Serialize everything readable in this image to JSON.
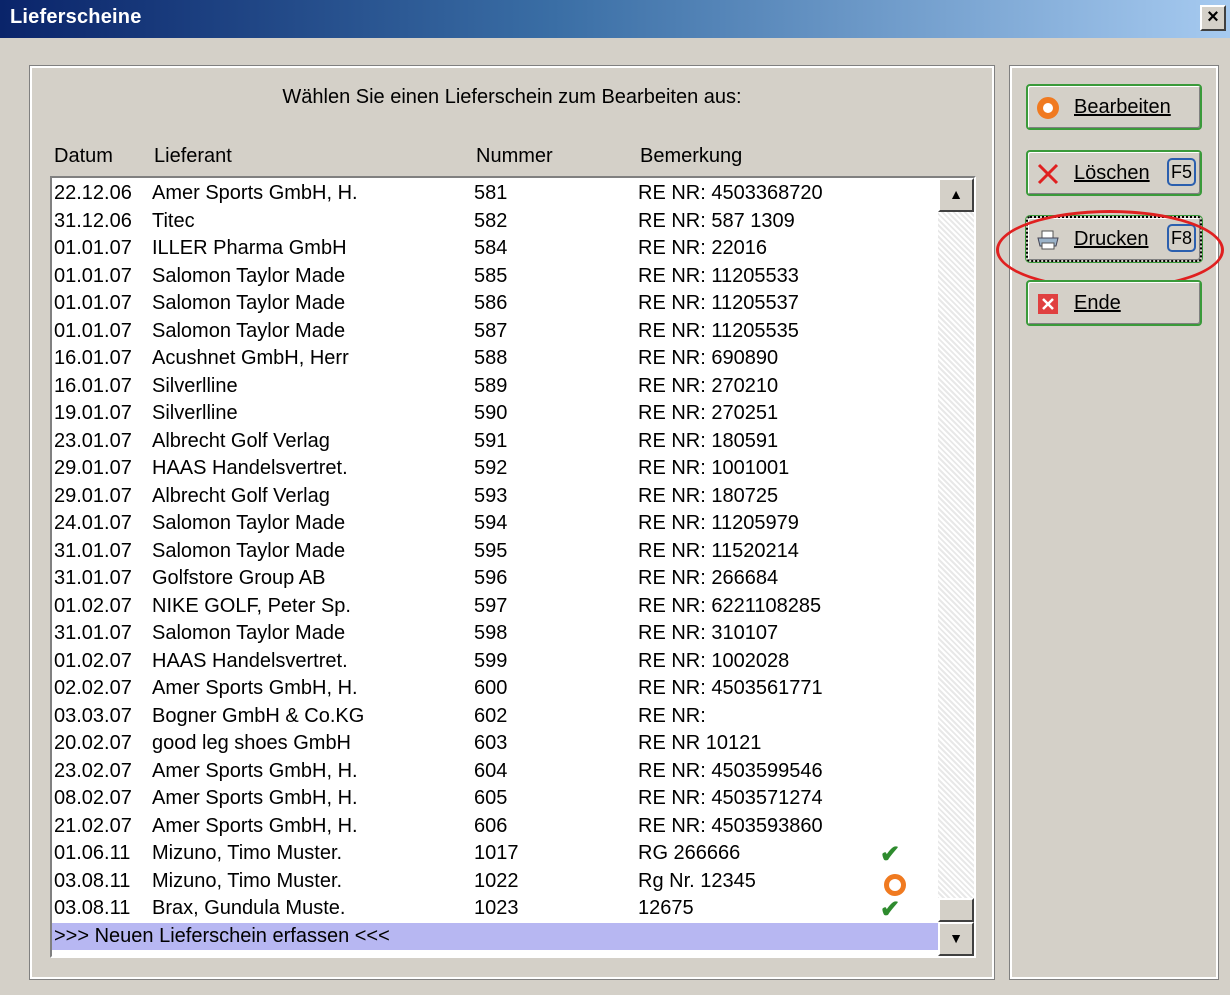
{
  "window": {
    "title": "Lieferscheine",
    "close_label": "×"
  },
  "instruction": "Wählen Sie einen Lieferschein zum Bearbeiten aus:",
  "columns": [
    "Datum",
    "Lieferant",
    "Nummer",
    "Bemerkung"
  ],
  "rows": [
    [
      "22.12.06",
      "Amer Sports GmbH, H.",
      "581",
      "RE NR: 4503368720",
      ""
    ],
    [
      "31.12.06",
      "Titec",
      "582",
      "RE NR: 587 1309",
      ""
    ],
    [
      "01.01.07",
      "ILLER Pharma GmbH",
      "584",
      "RE NR: 22016",
      ""
    ],
    [
      "01.01.07",
      "Salomon Taylor Made",
      "585",
      "RE NR: 11205533",
      ""
    ],
    [
      "01.01.07",
      "Salomon Taylor Made",
      "586",
      "RE NR: 11205537",
      ""
    ],
    [
      "01.01.07",
      "Salomon Taylor Made",
      "587",
      "RE NR: 11205535",
      ""
    ],
    [
      "16.01.07",
      "Acushnet GmbH, Herr",
      "588",
      "RE NR: 690890",
      ""
    ],
    [
      "16.01.07",
      "Silverlline",
      "589",
      "RE NR: 270210",
      ""
    ],
    [
      "19.01.07",
      "Silverlline",
      "590",
      "RE NR: 270251",
      ""
    ],
    [
      "23.01.07",
      "Albrecht Golf Verlag",
      "591",
      "RE NR: 180591",
      ""
    ],
    [
      "29.01.07",
      "HAAS Handelsvertret.",
      "592",
      "RE NR: 1001001",
      ""
    ],
    [
      "29.01.07",
      "Albrecht Golf Verlag",
      "593",
      "RE NR: 180725",
      ""
    ],
    [
      "24.01.07",
      "Salomon Taylor Made",
      "594",
      "RE NR: 11205979",
      ""
    ],
    [
      "31.01.07",
      "Salomon Taylor Made",
      "595",
      "RE NR: 11520214",
      ""
    ],
    [
      "31.01.07",
      "Golfstore Group AB",
      "596",
      "RE NR: 266684",
      ""
    ],
    [
      "01.02.07",
      "NIKE GOLF, Peter Sp.",
      "597",
      "RE NR: 6221108285",
      ""
    ],
    [
      "31.01.07",
      "Salomon Taylor Made",
      "598",
      "RE NR: 310107",
      ""
    ],
    [
      "01.02.07",
      "HAAS Handelsvertret.",
      "599",
      "RE NR: 1002028",
      ""
    ],
    [
      "02.02.07",
      "Amer Sports GmbH, H.",
      "600",
      "RE NR: 4503561771",
      ""
    ],
    [
      "03.03.07",
      "Bogner GmbH & Co.KG",
      "602",
      "RE NR:",
      ""
    ],
    [
      "20.02.07",
      "good leg shoes GmbH",
      "603",
      "RE NR 10121",
      ""
    ],
    [
      "23.02.07",
      "Amer Sports GmbH, H.",
      "604",
      "RE NR: 4503599546",
      ""
    ],
    [
      "08.02.07",
      "Amer Sports GmbH, H.",
      "605",
      "RE NR: 4503571274",
      ""
    ],
    [
      "21.02.07",
      "Amer Sports GmbH, H.",
      "606",
      "RE NR: 4503593860",
      ""
    ],
    [
      "01.06.11",
      "Mizuno, Timo Muster.",
      "1017",
      "RG 266666",
      "check-icon"
    ],
    [
      "03.08.11",
      "Mizuno, Timo Muster.",
      "1022",
      "Rg Nr. 12345",
      "ring-icon"
    ],
    [
      "03.08.11",
      "Brax, Gundula Muste.",
      "1023",
      "12675",
      "check-icon"
    ]
  ],
  "new_entry_label": ">>> Neuen Lieferschein erfassen <<<",
  "scrollbar": {
    "up_label": "▲",
    "down_label": "▼"
  },
  "buttons": {
    "edit": {
      "label": "Bearbeiten",
      "key": ""
    },
    "delete": {
      "label": "Löschen",
      "key": "F5"
    },
    "print": {
      "label": "Drucken",
      "key": "F8"
    },
    "exit": {
      "label": "Ende",
      "key": ""
    }
  },
  "colors": {
    "titlebar_start": "#0a246a",
    "titlebar_end": "#a6caf0",
    "new_entry_bg": "#b7b7f2",
    "check": "#2e8b2e",
    "ring": "#f07a20",
    "highlight": "#e02020"
  }
}
